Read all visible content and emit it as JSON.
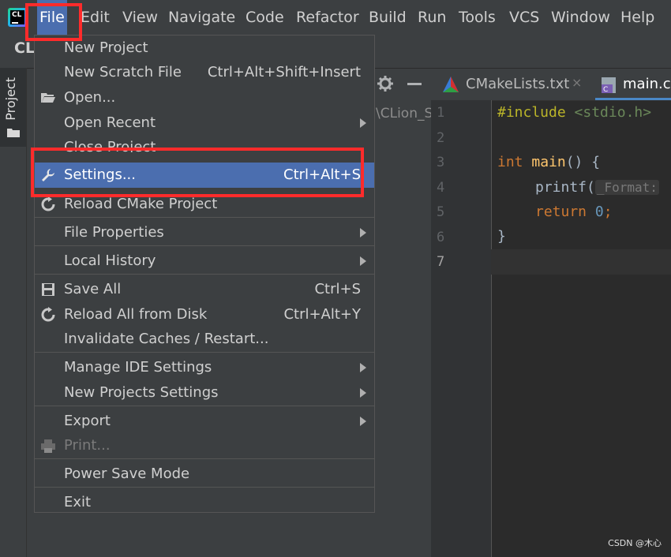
{
  "app": {
    "logo_text": "CL"
  },
  "menubar": {
    "items": [
      {
        "label": "File"
      },
      {
        "label": "Edit"
      },
      {
        "label": "View"
      },
      {
        "label": "Navigate"
      },
      {
        "label": "Code"
      },
      {
        "label": "Refactor"
      },
      {
        "label": "Build"
      },
      {
        "label": "Run"
      },
      {
        "label": "Tools"
      },
      {
        "label": "VCS"
      },
      {
        "label": "Window"
      },
      {
        "label": "Help"
      }
    ]
  },
  "toolbar": {
    "project_name": "CLi"
  },
  "tool_window": {
    "project_tab_label": "Project",
    "path_snippet": "\\CLion_S"
  },
  "editor": {
    "tabs": [
      {
        "label": "CMakeLists.txt",
        "close": "×"
      },
      {
        "label": "main.c"
      }
    ],
    "line_numbers": [
      "1",
      "2",
      "3",
      "4",
      "5",
      "6",
      "7"
    ],
    "code": {
      "l1_directive": "#include",
      "l1_header": "<stdio.h>",
      "l3_type": "int",
      "l3_fn": "main",
      "l3_rest": "() {",
      "l4_fn": "printf(",
      "l4_hint": "_Format:",
      "l5_kw": "return",
      "l5_num": "0",
      "l5_semi": ";",
      "l6": "}"
    }
  },
  "file_menu": {
    "items": [
      {
        "label": "New Project"
      },
      {
        "label": "New Scratch File",
        "shortcut": "Ctrl+Alt+Shift+Insert"
      },
      {
        "label": "Open..."
      },
      {
        "label": "Open Recent"
      },
      {
        "label": "Close Project"
      },
      {
        "label": "Settings...",
        "shortcut": "Ctrl+Alt+S"
      },
      {
        "label": "Reload CMake Project"
      },
      {
        "label": "File Properties"
      },
      {
        "label": "Local History"
      },
      {
        "label": "Save All",
        "shortcut": "Ctrl+S"
      },
      {
        "label": "Reload All from Disk",
        "shortcut": "Ctrl+Alt+Y"
      },
      {
        "label": "Invalidate Caches / Restart..."
      },
      {
        "label": "Manage IDE Settings"
      },
      {
        "label": "New Projects Settings"
      },
      {
        "label": "Export"
      },
      {
        "label": "Print..."
      },
      {
        "label": "Power Save Mode"
      },
      {
        "label": "Exit"
      }
    ]
  },
  "colors": {
    "highlight": "#4b6eaf",
    "annotation_red": "#ff2b2b",
    "menu_bg": "#3c3f41",
    "editor_bg": "#2b2b2b"
  },
  "watermark": "CSDN @木心"
}
